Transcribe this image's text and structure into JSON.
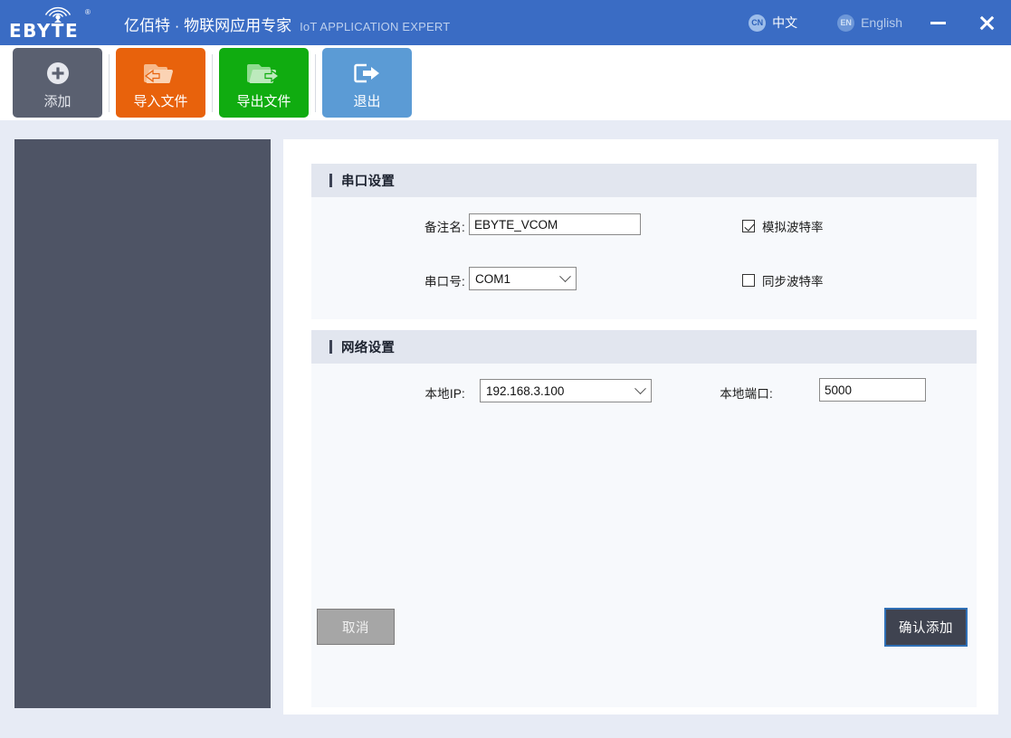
{
  "titlebar": {
    "logo_wordmark": "EBYTE",
    "logo_reg": "®",
    "logo_icon": "antenna-signal-icon",
    "brand_cn": "亿佰特 · 物联网应用专家",
    "brand_en": "IoT APPLICATION EXPERT",
    "languages": [
      {
        "badge": "CN",
        "label": "中文",
        "active": true
      },
      {
        "badge": "EN",
        "label": "English",
        "active": false
      }
    ],
    "minimize_tooltip": "最小化",
    "close_tooltip": "关闭",
    "bg_color": "#3a6cc4"
  },
  "toolbar": {
    "buttons": [
      {
        "label": "添加",
        "icon": "plus-circle-icon",
        "color": "#5a6070"
      },
      {
        "label": "导入文件",
        "icon": "folder-import-icon",
        "color": "#e8620c"
      },
      {
        "label": "导出文件",
        "icon": "folder-export-icon",
        "color": "#10ac10"
      },
      {
        "label": "退出",
        "icon": "exit-arrow-icon",
        "color": "#5b9bd5"
      }
    ]
  },
  "sections": {
    "serial": {
      "title": "串口设置",
      "remark_label": "备注名:",
      "remark_value": "EBYTE_VCOM",
      "remark_placeholder": "",
      "port_label": "串口号:",
      "port_value": "COM1",
      "port_options": [
        "COM1"
      ],
      "sim_baud_label": "模拟波特率",
      "sim_baud_checked": true,
      "sync_baud_label": "同步波特率",
      "sync_baud_checked": false
    },
    "network": {
      "title": "网络设置",
      "local_ip_label": "本地IP:",
      "local_ip_value": "192.168.3.100",
      "local_ip_options": [
        "192.168.3.100"
      ],
      "local_port_label": "本地端口:",
      "local_port_value": "5000",
      "local_port_placeholder": "",
      "local_port_focused": true
    }
  },
  "actions": {
    "cancel_label": "取消",
    "confirm_label": "确认添加"
  },
  "colors": {
    "accent_blue": "#3a6cc4",
    "focus_blue": "#0a7ad1",
    "page_bg": "#e7ebf5",
    "left_panel": "#4e5465",
    "section_header": "#e2e6ef",
    "section_body": "#f7f9fc"
  }
}
